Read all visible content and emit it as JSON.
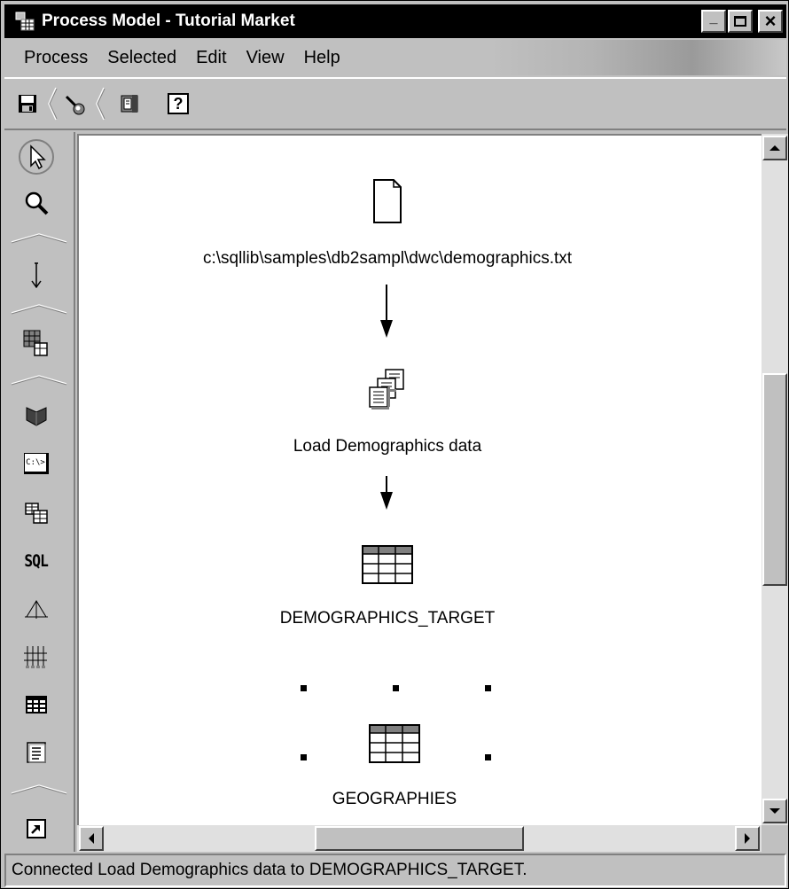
{
  "window": {
    "title": "Process Model - Tutorial Market",
    "minimize_symbol": "_",
    "maximize_symbol": "□",
    "close_symbol": "×"
  },
  "menu": [
    "Process",
    "Selected",
    "Edit",
    "View",
    "Help"
  ],
  "toolbar": {
    "buttons": [
      "save-icon",
      "link-tool-icon",
      "book-icon",
      "help-icon"
    ],
    "help_glyph": "?"
  },
  "palette": {
    "tools": [
      "select-arrow-icon",
      "zoom-icon",
      "task-flow-arrow-icon",
      "data-link-icon",
      "warehouse-program-icon",
      "command-prompt-icon",
      "table-copy-icon",
      "sql-icon",
      "transformer-icon",
      "statistics-icon",
      "table-icon",
      "file-icon",
      "shortcut-icon"
    ],
    "sql_label": "SQL",
    "cmd_label": "C:\\>"
  },
  "canvas": {
    "nodes": [
      {
        "label": "c:\\sqllib\\samples\\db2sampl\\dwc\\demographics.txt",
        "type": "file-icon"
      },
      {
        "label": "Load Demographics data",
        "type": "steps-icon"
      },
      {
        "label": "DEMOGRAPHICS_TARGET",
        "type": "table-icon"
      },
      {
        "label": "GEOGRAPHIES",
        "type": "table-icon",
        "selected": true
      }
    ]
  },
  "status": "Connected Load Demographics data to DEMOGRAPHICS_TARGET."
}
